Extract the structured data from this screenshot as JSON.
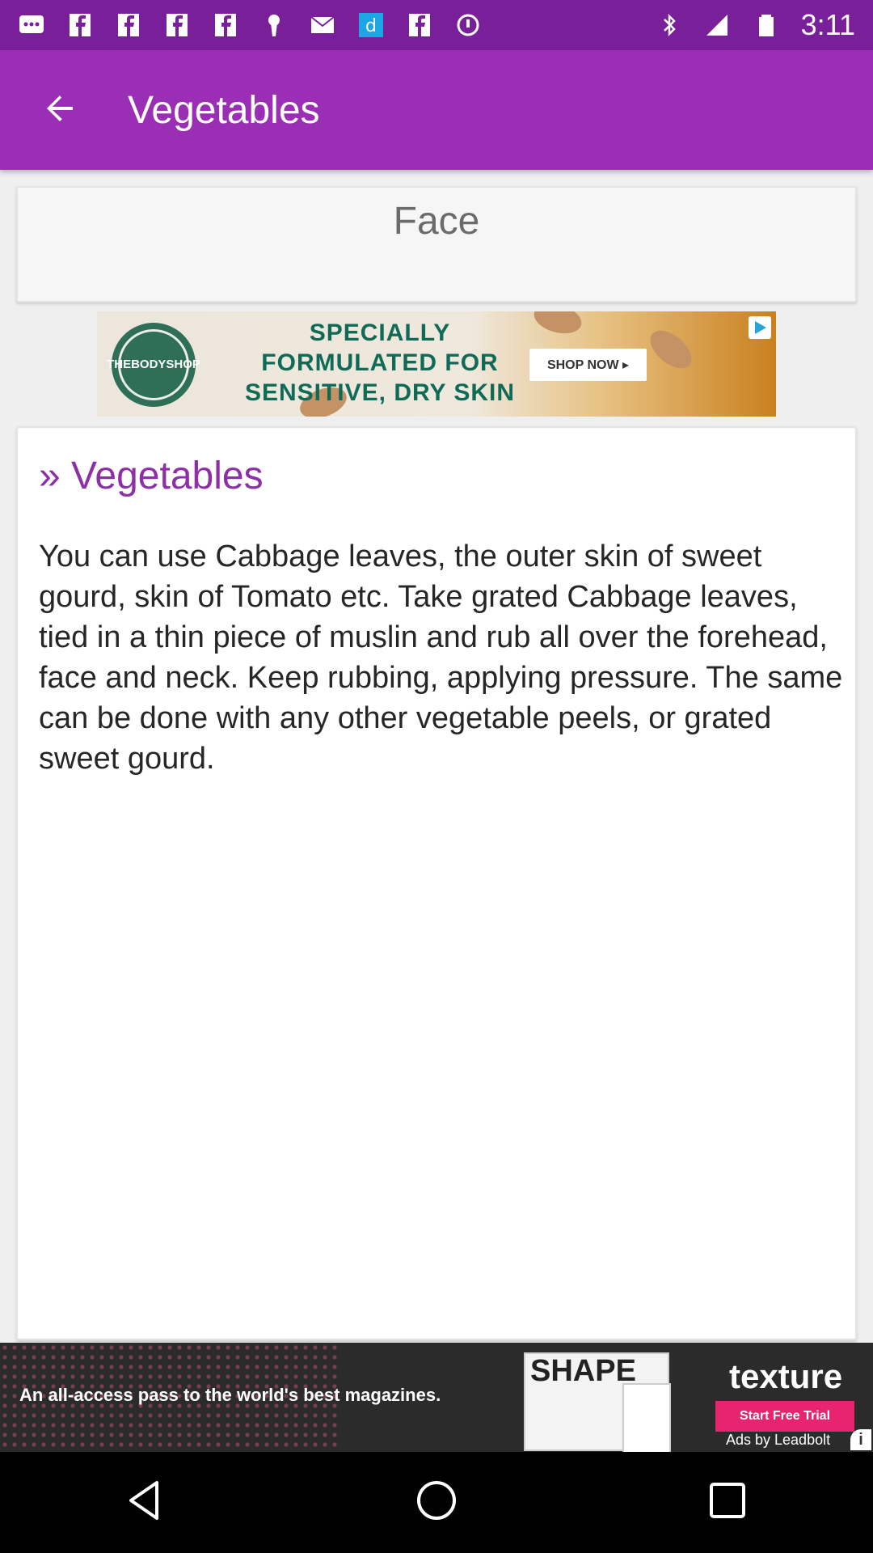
{
  "status_bar": {
    "time": "3:11",
    "icons": [
      "messaging-icon",
      "facebook-icon",
      "facebook-icon",
      "facebook-icon",
      "facebook-icon",
      "keyhole-icon",
      "email-icon",
      "dailyhunt-icon",
      "facebook-icon",
      "sync-icon",
      "bluetooth-icon",
      "signal-icon",
      "battery-icon"
    ]
  },
  "app_bar": {
    "title": "Vegetables",
    "back_icon": "arrow-back-icon"
  },
  "face_card": {
    "title": "Face"
  },
  "top_ad": {
    "brand_lines": [
      "THE",
      "BODY",
      "SHOP"
    ],
    "headline": "SPECIALLY FORMULATED FOR SENSITIVE, DRY SKIN",
    "cta": "SHOP NOW ▸"
  },
  "article": {
    "title": "» Vegetables",
    "body": "You can use Cabbage leaves, the outer skin of sweet gourd, skin of Tomato etc. Take grated Cabbage leaves, tied in a thin piece of muslin and rub all over the forehead, face and neck. Keep rubbing, applying pressure. The same can be done with any other vegetable peels, or grated sweet gourd."
  },
  "bottom_ad": {
    "tagline": "An all-access pass to the world's best magazines.",
    "magazine_title": "SHAPE",
    "brand": "texture",
    "cta": "Start Free Trial",
    "attribution": "Ads by Leadbolt",
    "info_icon": "i"
  },
  "colors": {
    "status_bar": "#7a1f9a",
    "app_bar": "#9a2fb5",
    "accent_text": "#8e2fa8"
  }
}
